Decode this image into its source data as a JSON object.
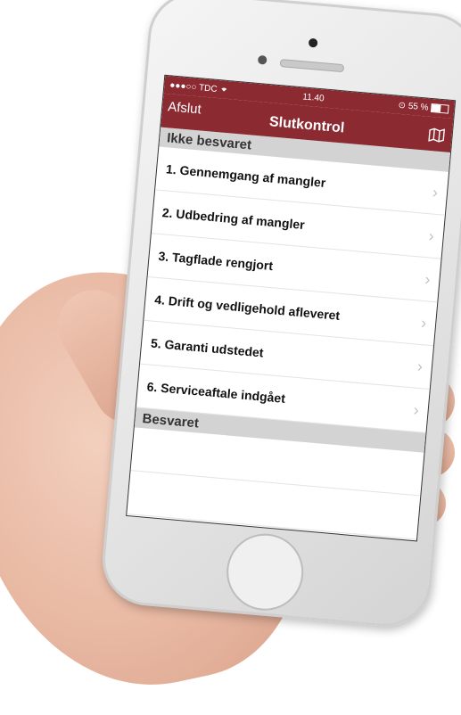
{
  "status_bar": {
    "carrier": "●●●○○ TDC",
    "wifi_icon": "wifi-icon",
    "time": "11.40",
    "battery": "55 %"
  },
  "nav": {
    "back_label": "Afslut",
    "title": "Slutkontrol",
    "right_icon": "map-icon"
  },
  "sections": [
    {
      "header": "Ikke besvaret",
      "items": [
        "1. Gennemgang af mangler",
        "2. Udbedring af mangler",
        "3. Tagflade rengjort",
        "4. Drift og vedligehold afleveret",
        "5. Garanti udstedet",
        "6. Serviceaftale indgået"
      ]
    },
    {
      "header": "Besvaret",
      "items": []
    }
  ],
  "colors": {
    "accent": "#8c2a32",
    "section_bg": "#d3d3d3"
  }
}
